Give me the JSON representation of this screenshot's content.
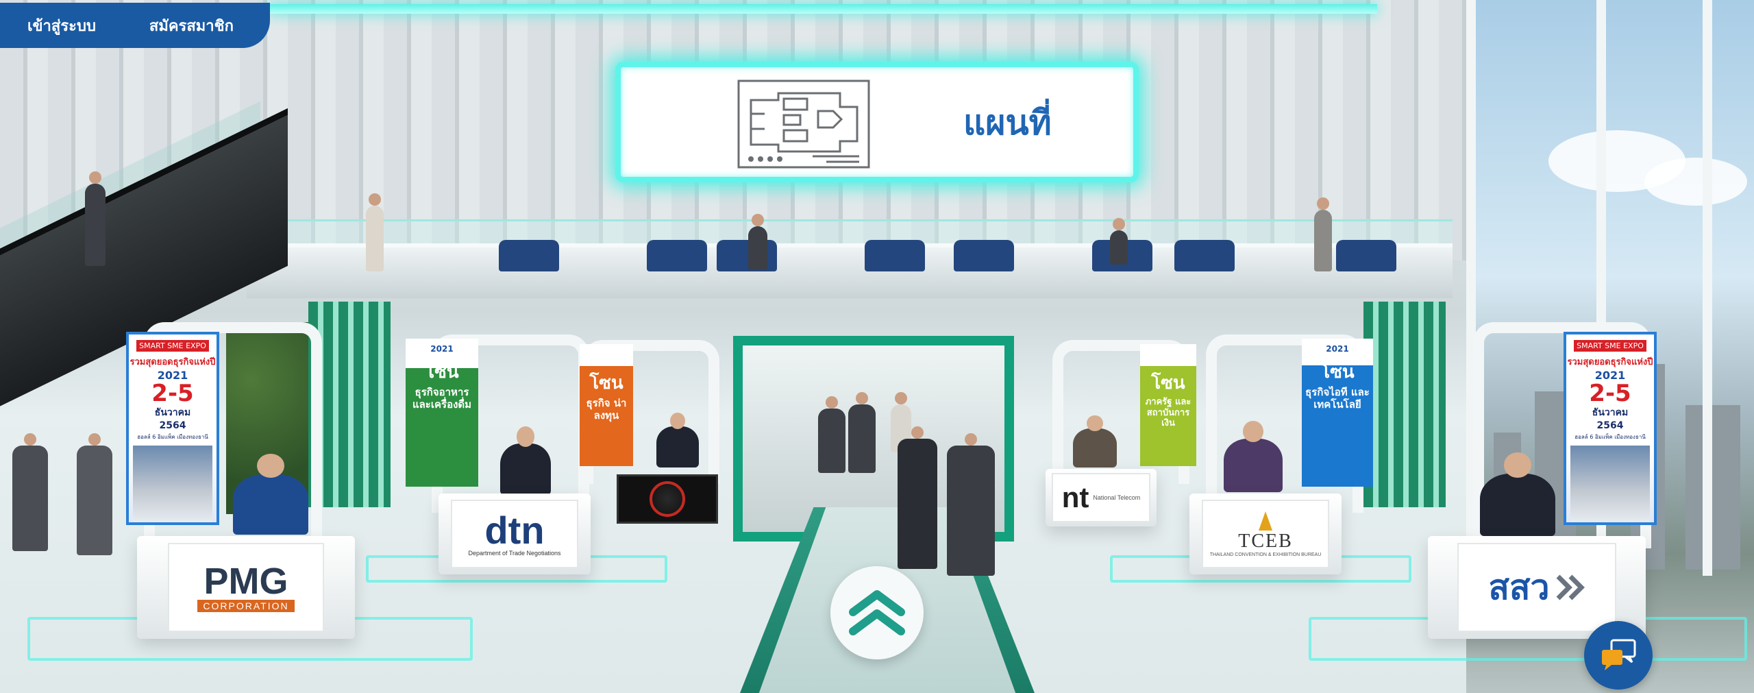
{
  "header": {
    "login_label": "เข้าสู่ระบบ",
    "register_label": "สมัครสมาชิก"
  },
  "map_sign": {
    "label": "แผนที่",
    "icon": "floor-plan-icon"
  },
  "booths": [
    {
      "id": "pmg",
      "logo_text": "PMG",
      "logo_sub": "CORPORATION"
    },
    {
      "id": "dtn",
      "logo_text": "dtn",
      "logo_sub": "Department of Trade Negotiations"
    },
    {
      "id": "nt",
      "logo_text": "nt",
      "logo_sub": "National Telecom"
    },
    {
      "id": "tceb",
      "logo_text": "TCEB",
      "logo_sub": "THAILAND CONVENTION & EXHIBITION BUREAU"
    },
    {
      "id": "sorsorwor",
      "logo_text": "สสว"
    }
  ],
  "posters": {
    "expo": {
      "tag": "SMART SME EXPO",
      "headline": "รวมสุดยอดธุรกิจแห่งปี",
      "year": "2021",
      "dates": "2-5",
      "month": "ธันวาคม",
      "thai_year": "2564",
      "venue": "ฮอลล์ 6 อิมแพ็ค เมืองทองธานี"
    },
    "zone_food": {
      "zone": "โซน",
      "title": "ธุรกิจอาหาร และเครื่องดื่ม",
      "year": "2021"
    },
    "zone_invest": {
      "zone": "โซน",
      "title": "ธุรกิจ น่าลงทุน"
    },
    "zone_gov": {
      "zone": "โซน",
      "title": "ภาครัฐ และสถาบันการเงิน"
    },
    "zone_it": {
      "zone": "โซน",
      "title": "ธุรกิจไอที และเทคโนโลยี",
      "year": "2021"
    }
  },
  "controls": {
    "up_icon": "double-chevron-up-icon",
    "chat_icon": "chat-bubbles-icon"
  },
  "colors": {
    "brand_blue": "#1a5aa3",
    "neon_cyan": "#5ff4ea",
    "map_text": "#2066b4",
    "teal": "#12a07d"
  }
}
